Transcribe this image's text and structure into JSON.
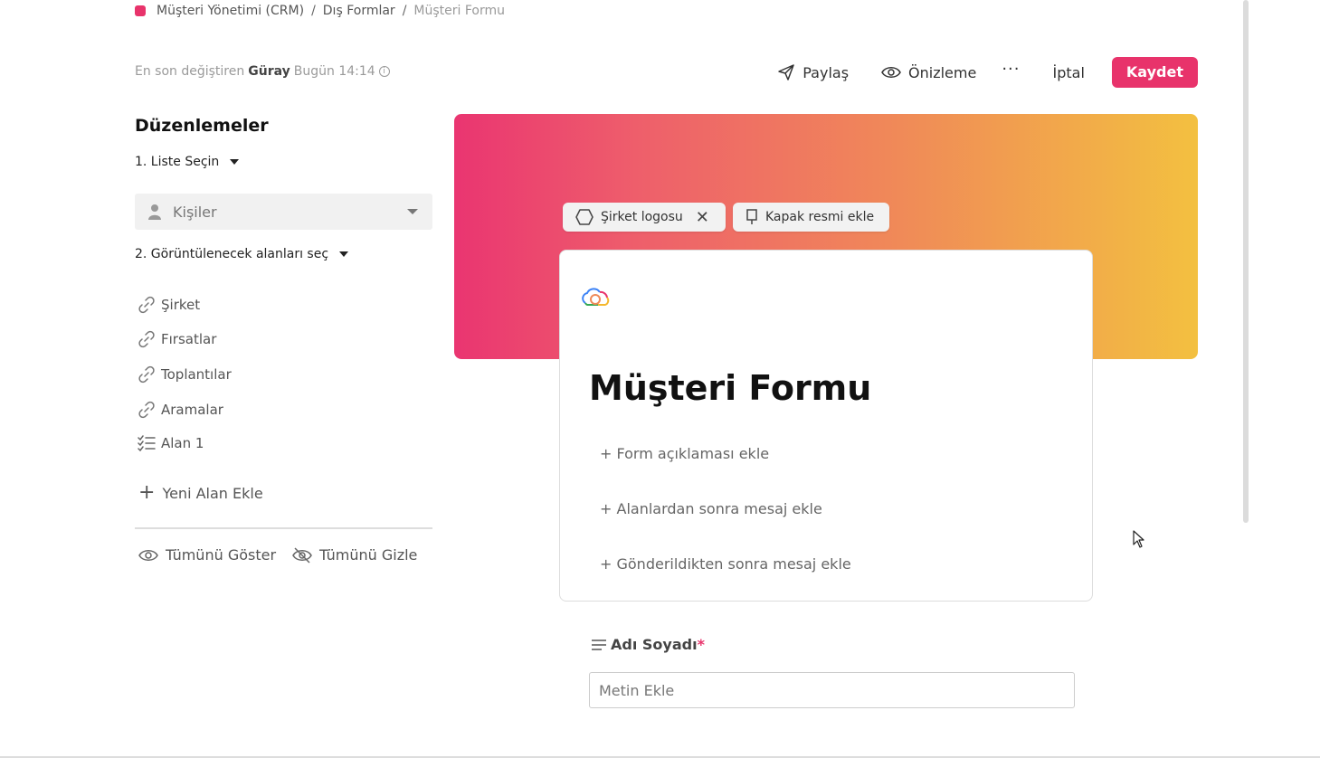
{
  "breadcrumb": {
    "items": [
      "Müşteri Yönetimi (CRM)",
      "Dış Formlar",
      "Müşteri Formu"
    ],
    "separator": "/",
    "accent_color": "#e8336b"
  },
  "modified": {
    "prefix": "En son değiştiren",
    "user": "Güray",
    "time": "Bugün 14:14",
    "info_icon": "i"
  },
  "toolbar": {
    "share_label": "Paylaş",
    "preview_label": "Önizleme",
    "more_label": "···",
    "cancel_label": "İptal",
    "save_label": "Kaydet"
  },
  "sidebar": {
    "title": "Düzenlemeler",
    "step1": "1.  Liste Seçin",
    "list_select_value": "Kişiler",
    "step2": "2.  Görüntülenecek alanları seç",
    "fields": [
      {
        "label": "Şirket",
        "icon": "link-icon"
      },
      {
        "label": "Fırsatlar",
        "icon": "link-icon"
      },
      {
        "label": "Toplantılar",
        "icon": "link-icon"
      },
      {
        "label": "Aramalar",
        "icon": "link-icon"
      },
      {
        "label": "Alan 1",
        "icon": "checklist-icon"
      }
    ],
    "add_field_label": "Yeni Alan Ekle",
    "show_all_label": "Tümünü Göster",
    "hide_all_label": "Tümünü Gizle"
  },
  "cover": {
    "logo_chip_label": "Şirket logosu",
    "cover_chip_label": "Kapak resmi ekle",
    "gradient_colors": [
      "#ea3571",
      "#f08a58",
      "#f3c040"
    ]
  },
  "form": {
    "title": "Müşteri Formu",
    "links": [
      "+ Form açıklaması ekle",
      "+ Alanlardan sonra mesaj ekle",
      "+ Gönderildikten sonra mesaj ekle"
    ],
    "question_label": "Adı Soyadı",
    "required_mark": "*",
    "input_placeholder": "Metin Ekle"
  }
}
